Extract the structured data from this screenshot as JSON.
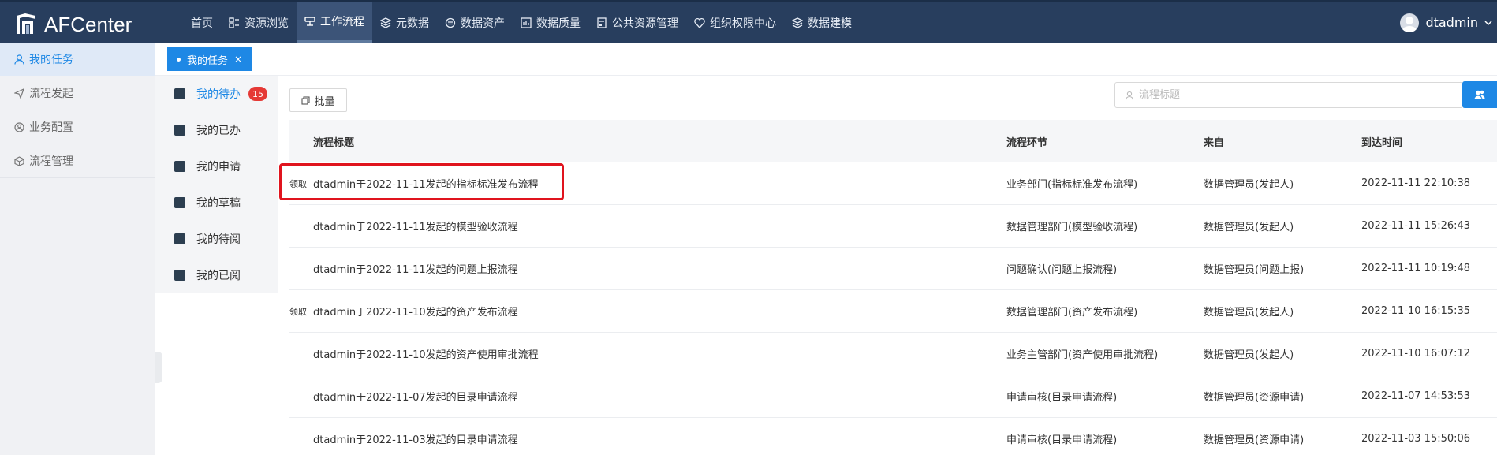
{
  "app": {
    "logo_text": "AFCenter"
  },
  "nav": {
    "items": [
      {
        "label": "首页",
        "icon": "none"
      },
      {
        "label": "资源浏览",
        "icon": "grid-icon"
      },
      {
        "label": "工作流程",
        "icon": "workflow-icon",
        "active": true
      },
      {
        "label": "元数据",
        "icon": "layers-icon"
      },
      {
        "label": "数据资产",
        "icon": "asset-icon"
      },
      {
        "label": "数据质量",
        "icon": "chart-icon"
      },
      {
        "label": "公共资源管理",
        "icon": "file-icon"
      },
      {
        "label": "组织权限中心",
        "icon": "shield-icon"
      },
      {
        "label": "数据建模",
        "icon": "layers-icon"
      }
    ],
    "user": "dtadmin"
  },
  "sidebar": {
    "items": [
      {
        "label": "我的任务",
        "icon": "user-icon",
        "active": true
      },
      {
        "label": "流程发起",
        "icon": "send-icon"
      },
      {
        "label": "业务配置",
        "icon": "settings-icon"
      },
      {
        "label": "流程管理",
        "icon": "cube-icon"
      }
    ]
  },
  "tabs": [
    {
      "label": "我的任务",
      "close": "×"
    }
  ],
  "submenu": {
    "items": [
      {
        "label": "我的待办",
        "badge": "15",
        "active": true
      },
      {
        "label": "我的已办"
      },
      {
        "label": "我的申请"
      },
      {
        "label": "我的草稿"
      },
      {
        "label": "我的待阅"
      },
      {
        "label": "我的已阅"
      }
    ]
  },
  "toolbar": {
    "batch_label": "批量"
  },
  "search": {
    "placeholder": "流程标题"
  },
  "table": {
    "headers": {
      "title": "流程标题",
      "step": "流程环节",
      "from": "来自",
      "time": "到达时间"
    },
    "rows": [
      {
        "claim": "领取",
        "title": "dtadmin于2022-11-11发起的指标标准发布流程",
        "step": "业务部门(指标标准发布流程)",
        "from": "数据管理员(发起人)",
        "time": "2022-11-11 22:10:38"
      },
      {
        "claim": "",
        "title": "dtadmin于2022-11-11发起的模型验收流程",
        "step": "数据管理部门(模型验收流程)",
        "from": "数据管理员(发起人)",
        "time": "2022-11-11 15:26:43"
      },
      {
        "claim": "",
        "title": "dtadmin于2022-11-11发起的问题上报流程",
        "step": "问题确认(问题上报流程)",
        "from": "数据管理员(问题上报)",
        "time": "2022-11-11 10:19:48"
      },
      {
        "claim": "领取",
        "title": "dtadmin于2022-11-10发起的资产发布流程",
        "step": "数据管理部门(资产发布流程)",
        "from": "数据管理员(发起人)",
        "time": "2022-11-10 16:15:35"
      },
      {
        "claim": "",
        "title": "dtadmin于2022-11-10发起的资产使用审批流程",
        "step": "业务主管部门(资产使用审批流程)",
        "from": "数据管理员(发起人)",
        "time": "2022-11-10 16:07:12"
      },
      {
        "claim": "",
        "title": "dtadmin于2022-11-07发起的目录申请流程",
        "step": "申请审核(目录申请流程)",
        "from": "数据管理员(资源申请)",
        "time": "2022-11-07 14:53:53"
      },
      {
        "claim": "",
        "title": "dtadmin于2022-11-03发起的目录申请流程",
        "step": "申请审核(目录申请流程)",
        "from": "数据管理员(资源申请)",
        "time": "2022-11-03 15:50:06"
      }
    ]
  },
  "colors": {
    "nav_bg": "#283e5e",
    "accent": "#1e88e5",
    "badge": "#e53935",
    "highlight_border": "#e0141e"
  }
}
